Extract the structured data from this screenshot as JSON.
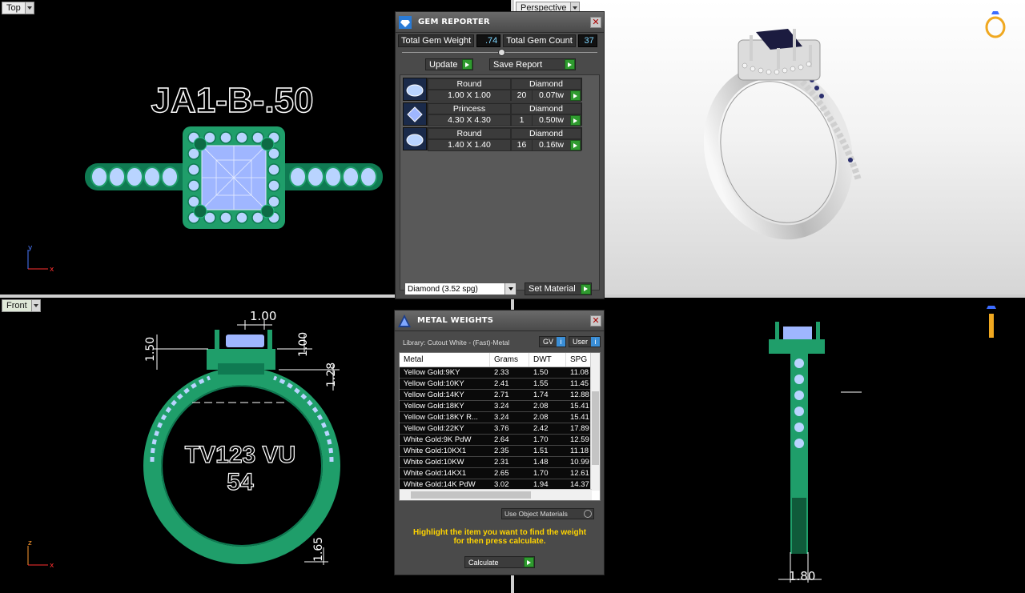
{
  "viewports": {
    "top": {
      "label": "Top",
      "engraving": "JA1-B-.50",
      "axis_y": "y",
      "axis_x": "x"
    },
    "perspective": {
      "label": "Perspective"
    },
    "front": {
      "label": "Front",
      "engraving_line1": "TV123 VU",
      "engraving_line2": "54",
      "axis_z": "z",
      "axis_x": "x",
      "dims": {
        "top_width": "1.00",
        "height_left": "1.50",
        "height_right": "1.00",
        "gap": "1.28",
        "shank": "1.65"
      }
    },
    "right": {
      "dim_bottom": "1.80"
    }
  },
  "gem_reporter": {
    "title": "GEM REPORTER",
    "close": "✕",
    "total_weight_label": "Total Gem Weight",
    "total_weight_value": ".74",
    "total_count_label": "Total Gem Count",
    "total_count_value": "37",
    "update_label": "Update",
    "save_label": "Save Report",
    "gems": [
      {
        "shape": "Round",
        "size": "1.00 X 1.00",
        "material": "Diamond",
        "count": "20",
        "weight": "0.07tw"
      },
      {
        "shape": "Princess",
        "size": "4.30 X 4.30",
        "material": "Diamond",
        "count": "1",
        "weight": "0.50tw"
      },
      {
        "shape": "Round",
        "size": "1.40 X 1.40",
        "material": "Diamond",
        "count": "16",
        "weight": "0.16tw"
      }
    ],
    "material_select": "Diamond    (3.52 spg)",
    "set_material_label": "Set Material"
  },
  "metal_weights": {
    "title": "METAL WEIGHTS",
    "close": "✕",
    "library": "Library: Cutout White - (Fast)-Metal",
    "gv_label": "GV",
    "user_label": "User",
    "columns": [
      "Metal",
      "Grams",
      "DWT",
      "SPG"
    ],
    "rows": [
      [
        "Yellow Gold:9KY",
        "2.33",
        "1.50",
        "11.08"
      ],
      [
        "Yellow Gold:10KY",
        "2.41",
        "1.55",
        "11.45"
      ],
      [
        "Yellow Gold:14KY",
        "2.71",
        "1.74",
        "12.88"
      ],
      [
        "Yellow Gold:18KY",
        "3.24",
        "2.08",
        "15.41"
      ],
      [
        "Yellow Gold:18KY R...",
        "3.24",
        "2.08",
        "15.41"
      ],
      [
        "Yellow Gold:22KY",
        "3.76",
        "2.42",
        "17.89"
      ],
      [
        "White Gold:9K PdW",
        "2.64",
        "1.70",
        "12.59"
      ],
      [
        "White Gold:10KX1",
        "2.35",
        "1.51",
        "11.18"
      ],
      [
        "White Gold:10KW",
        "2.31",
        "1.48",
        "10.99"
      ],
      [
        "White Gold:14KX1",
        "2.65",
        "1.70",
        "12.61"
      ],
      [
        "White Gold:14K PdW",
        "3.02",
        "1.94",
        "14.37"
      ]
    ],
    "use_object_materials": "Use Object Materials",
    "hint_line1": "Highlight the item you want to find the weight",
    "hint_line2": "for then press calculate.",
    "calculate_label": "Calculate"
  },
  "colors": {
    "model_green": "#1f9e6a",
    "gem_blue": "#9fb6ff",
    "panel_bg": "#4a4a4a",
    "accent_green": "#2f9b2f",
    "hint_yellow": "#ffd400"
  },
  "icons": [
    "gem-reporter-icon",
    "metal-weights-icon",
    "ring-perspective-icon",
    "ring-side-icon"
  ]
}
